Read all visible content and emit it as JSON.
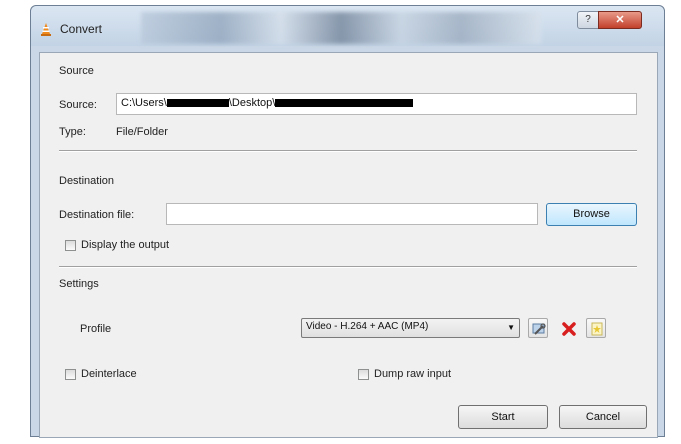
{
  "window": {
    "title": "Convert",
    "help_label": "?",
    "close_label": "✕"
  },
  "source": {
    "section_title": "Source",
    "source_label": "Source:",
    "source_value_prefix": "C:\\Users\\",
    "source_value_middle": "\\Desktop\\",
    "type_label": "Type:",
    "type_value": "File/Folder"
  },
  "destination": {
    "section_title": "Destination",
    "file_label": "Destination file:",
    "file_value": "",
    "browse_label": "Browse",
    "display_output_label": "Display the output"
  },
  "settings": {
    "section_title": "Settings",
    "profile_label": "Profile",
    "profile_selected": "Video - H.264 + AAC (MP4)",
    "deinterlace_label": "Deinterlace",
    "dump_raw_label": "Dump raw input"
  },
  "actions": {
    "start_label": "Start",
    "cancel_label": "Cancel"
  },
  "colors": {
    "accent": "#3c7fb1",
    "delete_red": "#d81e1e"
  }
}
